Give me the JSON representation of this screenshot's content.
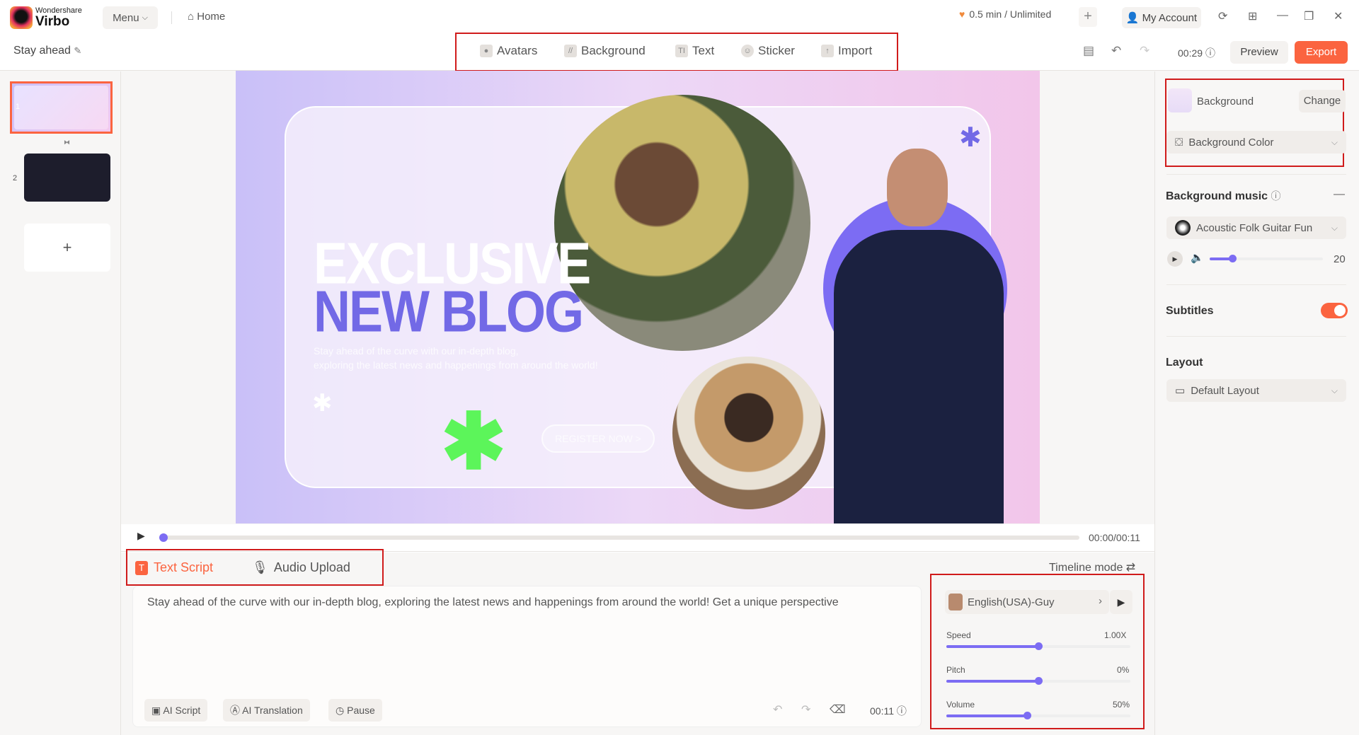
{
  "app": {
    "brand_top": "Wondershare",
    "brand_name": "Virbo",
    "menu": "Menu",
    "home": "Home",
    "quota": "0.5 min / Unlimited",
    "account": "My Account"
  },
  "project": {
    "title": "Stay ahead",
    "duration": "00:29",
    "preview": "Preview",
    "export": "Export"
  },
  "toolbar": {
    "items": [
      "Avatars",
      "Background",
      "Text",
      "Sticker",
      "Import"
    ]
  },
  "slides": [
    {
      "number": "1"
    },
    {
      "number": "2"
    }
  ],
  "canvas": {
    "headline1": "EXCLUSIVE",
    "headline2": "NEW BLOG",
    "subtitle1": "Stay ahead of the curve with our in-depth blog,",
    "subtitle2": "exploring the latest news and happenings from around the world!",
    "button": "REGISTER NOW >"
  },
  "player": {
    "time": "00:00/00:11",
    "progress": 0
  },
  "script": {
    "tabs": [
      "Text Script",
      "Audio Upload"
    ],
    "timeline_mode": "Timeline mode",
    "text": "Stay ahead of the curve with our in-depth blog, exploring the latest news and happenings from around the world! Get a unique perspective",
    "buttons": [
      "AI Script",
      "AI Translation",
      "Pause"
    ],
    "duration": "00:11"
  },
  "voice": {
    "name": "English(USA)-Guy",
    "speed_label": "Speed",
    "speed": "1.00X",
    "speed_fill": 50,
    "pitch_label": "Pitch",
    "pitch": "0%",
    "pitch_fill": 50,
    "volume_label": "Volume",
    "volume": "50%",
    "volume_fill": 44
  },
  "right": {
    "bg_label": "Background",
    "change": "Change",
    "bg_color": "Background Color",
    "music_title": "Background music",
    "music": "Acoustic Folk Guitar Fun",
    "music_volume": "20",
    "subtitles": "Subtitles",
    "subtitles_on": true,
    "layout_title": "Layout",
    "layout": "Default Layout"
  },
  "colors": {
    "accent": "#fb6440",
    "slider": "#7c6cf3",
    "highlight": "#d01b1b"
  }
}
